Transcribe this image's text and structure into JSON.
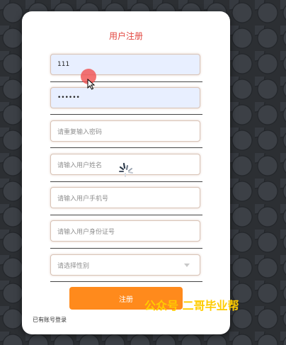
{
  "form": {
    "title": "用户注册",
    "fields": [
      {
        "value": "111",
        "placeholder": ""
      },
      {
        "value": "••••••",
        "placeholder": ""
      },
      {
        "value": "",
        "placeholder": "请重复输入密码"
      },
      {
        "value": "",
        "placeholder": "请输入用户姓名"
      },
      {
        "value": "",
        "placeholder": "请输入用户手机号"
      },
      {
        "value": "",
        "placeholder": "请输入用户身份证号"
      },
      {
        "value": "",
        "placeholder": "请选择性别"
      }
    ],
    "submit_label": "注册",
    "login_link": "已有账号登录"
  },
  "watermark": "公众号 二哥毕业帮",
  "colors": {
    "title": "#e2463f",
    "submit": "#ff8a1c",
    "watermark": "#ffcc00"
  }
}
